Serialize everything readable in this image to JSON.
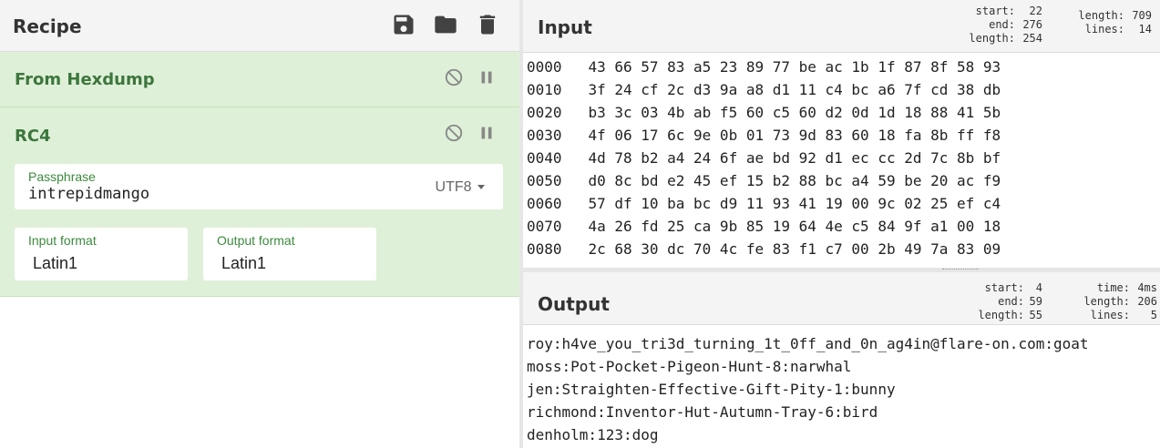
{
  "recipe": {
    "title": "Recipe",
    "header_icons": [
      "save-icon",
      "folder-icon",
      "trash-icon"
    ],
    "operations": [
      {
        "name": "From Hexdump",
        "controls": [
          "disable-icon",
          "pause-icon"
        ]
      },
      {
        "name": "RC4",
        "controls": [
          "disable-icon",
          "pause-icon"
        ],
        "passphrase": {
          "label": "Passphrase",
          "value": "intrepidmango",
          "encoding": "UTF8"
        },
        "input_format": {
          "label": "Input format",
          "value": "Latin1"
        },
        "output_format": {
          "label": "Output format",
          "value": "Latin1"
        }
      }
    ],
    "colors": {
      "op_bg": "#dff0d8",
      "op_title": "#3c763d"
    }
  },
  "input": {
    "title": "Input",
    "stats": {
      "start": "22",
      "end": "276",
      "length_sel": "254",
      "length": "709",
      "lines": "14"
    },
    "lines": [
      {
        "offset": "0000",
        "bytes": "43 66 57 83 a5 23 89 77 be ac 1b 1f 87 8f 58 93"
      },
      {
        "offset": "0010",
        "bytes": "3f 24 cf 2c d3 9a a8 d1 11 c4 bc a6 7f cd 38 db"
      },
      {
        "offset": "0020",
        "bytes": "b3 3c 03 4b ab f5 60 c5 60 d2 0d 1d 18 88 41 5b"
      },
      {
        "offset": "0030",
        "bytes": "4f 06 17 6c 9e 0b 01 73 9d 83 60 18 fa 8b ff f8"
      },
      {
        "offset": "0040",
        "bytes": "4d 78 b2 a4 24 6f ae bd 92 d1 ec cc 2d 7c 8b bf"
      },
      {
        "offset": "0050",
        "bytes": "d0 8c bd e2 45 ef 15 b2 88 bc a4 59 be 20 ac f9"
      },
      {
        "offset": "0060",
        "bytes": "57 df 10 ba bc d9 11 93 41 19 00 9c 02 25 ef c4"
      },
      {
        "offset": "0070",
        "bytes": "4a 26 fd 25 ca 9b 85 19 64 4e c5 84 9f a1 00 18"
      },
      {
        "offset": "0080",
        "bytes": "2c 68 30 dc 70 4c fe 83 f1 c7 00 2b 49 7a 83 09"
      }
    ]
  },
  "output": {
    "title": "Output",
    "stats": {
      "start": "4",
      "end": "59",
      "length_sel": "55",
      "time": "4ms",
      "length": "206",
      "lines": "5"
    },
    "lines": [
      "roy:h4ve_you_tri3d_turning_1t_0ff_and_0n_ag4in@flare-on.com:goat",
      "moss:Pot-Pocket-Pigeon-Hunt-8:narwhal",
      "jen:Straighten-Effective-Gift-Pity-1:bunny",
      "richmond:Inventor-Hut-Autumn-Tray-6:bird",
      "denholm:123:dog"
    ]
  },
  "labels": {
    "start": "start:",
    "end": "end:",
    "length": "length:",
    "lines": "lines:",
    "time": "time:"
  }
}
